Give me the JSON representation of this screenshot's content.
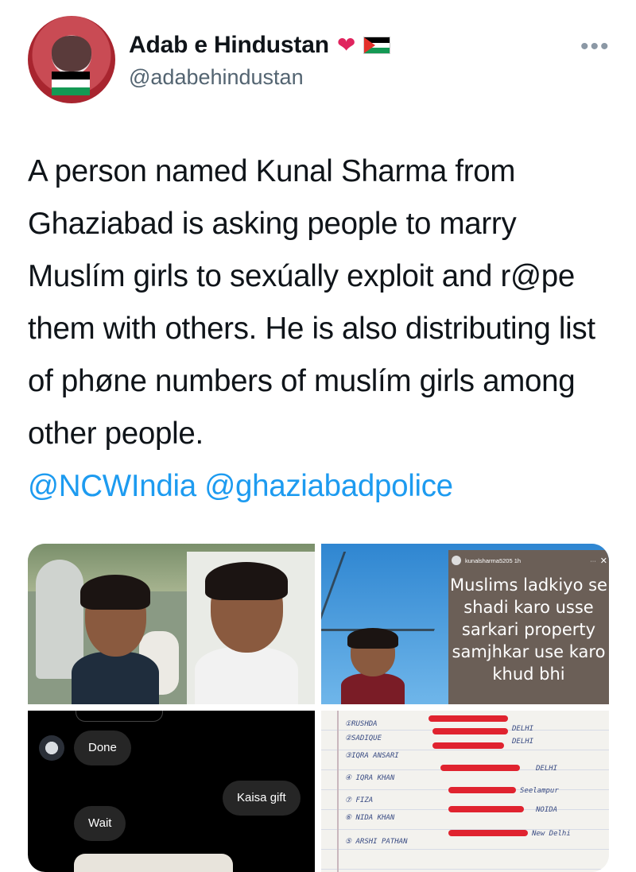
{
  "author": {
    "name": "Adab e Hindustan",
    "handle": "@adabehindustan",
    "emoji_heart": "❤️",
    "flag_icon": "palestine-flag-icon"
  },
  "more_label": "•••",
  "tweet": {
    "text": "A person named Kunal Sharma from Ghaziabad is asking people to marry Muslím girls to sexúally exploit and r@pe them with others. He is also distributing list of phøne numbers of muslím girls among other people.",
    "mention_1": "@NCWIndia",
    "mention_2": "@ghaziabadpolice"
  },
  "media": {
    "story": {
      "username": "kunalsharma5205",
      "time": "1h",
      "text": "Muslims ladkiyo se shadi karo usse sarkari property samjhkar use karo khud bhi"
    },
    "chat": {
      "messages": [
        {
          "text": "Done",
          "side": "received"
        },
        {
          "text": "Kaisa gift",
          "side": "sent"
        },
        {
          "text": "Wait",
          "side": "received"
        }
      ]
    }
  },
  "colors": {
    "link": "#1d9bf0",
    "text": "#0f1419",
    "muted": "#536471",
    "redaction": "#e0232f"
  }
}
